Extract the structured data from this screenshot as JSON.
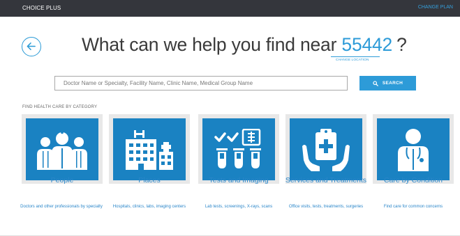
{
  "topbar": {
    "plan_name": "CHOICE PLUS",
    "change_plan": "CHANGE PLAN"
  },
  "header": {
    "headline_prefix": "What can we help you find near",
    "zip": "55442",
    "headline_suffix": "?",
    "change_location": "CHANGE LOCATION",
    "back_icon": "arrow-left-circle-icon"
  },
  "search": {
    "placeholder": "Doctor Name or Specialty, Facility Name, Clinic Name, Medical Group Name",
    "value": "",
    "button_label": "SEARCH",
    "button_icon": "search-icon"
  },
  "categories": {
    "heading": "FIND HEALTH CARE BY CATEGORY",
    "items": [
      {
        "title": "People",
        "description": "Doctors and other professionals by specialty",
        "icon": "people-icon"
      },
      {
        "title": "Places",
        "description": "Hospitals, clinics, labs, imaging centers",
        "icon": "buildings-icon"
      },
      {
        "title": "Tests and Imaging",
        "description": "Lab tests, screenings, X-rays, scans",
        "icon": "test-tubes-icon"
      },
      {
        "title": "Services and Treatments",
        "description": "Office visits, tests, treatments, surgeries",
        "icon": "clipboard-hands-icon"
      },
      {
        "title": "Care by Condition",
        "description": "Find care for common concerns",
        "icon": "doctor-icon"
      }
    ]
  },
  "colors": {
    "topbar": "#34363c",
    "accent": "#2d9bd8",
    "tile": "#1a82c2",
    "tile_border": "#e8e8e8",
    "link": "#2a86c9"
  }
}
